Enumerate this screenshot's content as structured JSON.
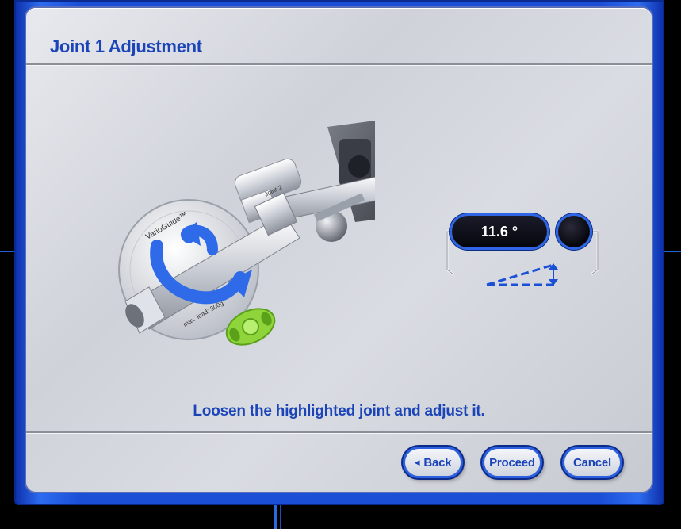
{
  "dialog": {
    "title": "Joint 1 Adjustment",
    "instruction": "Loosen the highlighted joint and adjust it."
  },
  "angle_display": {
    "value": "11.6 °"
  },
  "illustration": {
    "device_brand": "VarioGuide™",
    "joint_label": "Joint 2",
    "load_label": "max. load: 300g"
  },
  "buttons": {
    "back": "Back",
    "proceed": "Proceed",
    "cancel": "Cancel"
  },
  "colors": {
    "accent_blue": "#1a44b8",
    "frame_blue": "#1a4fd6",
    "highlight_green": "#8ed43a",
    "arrow_blue": "#2f6ae8"
  }
}
